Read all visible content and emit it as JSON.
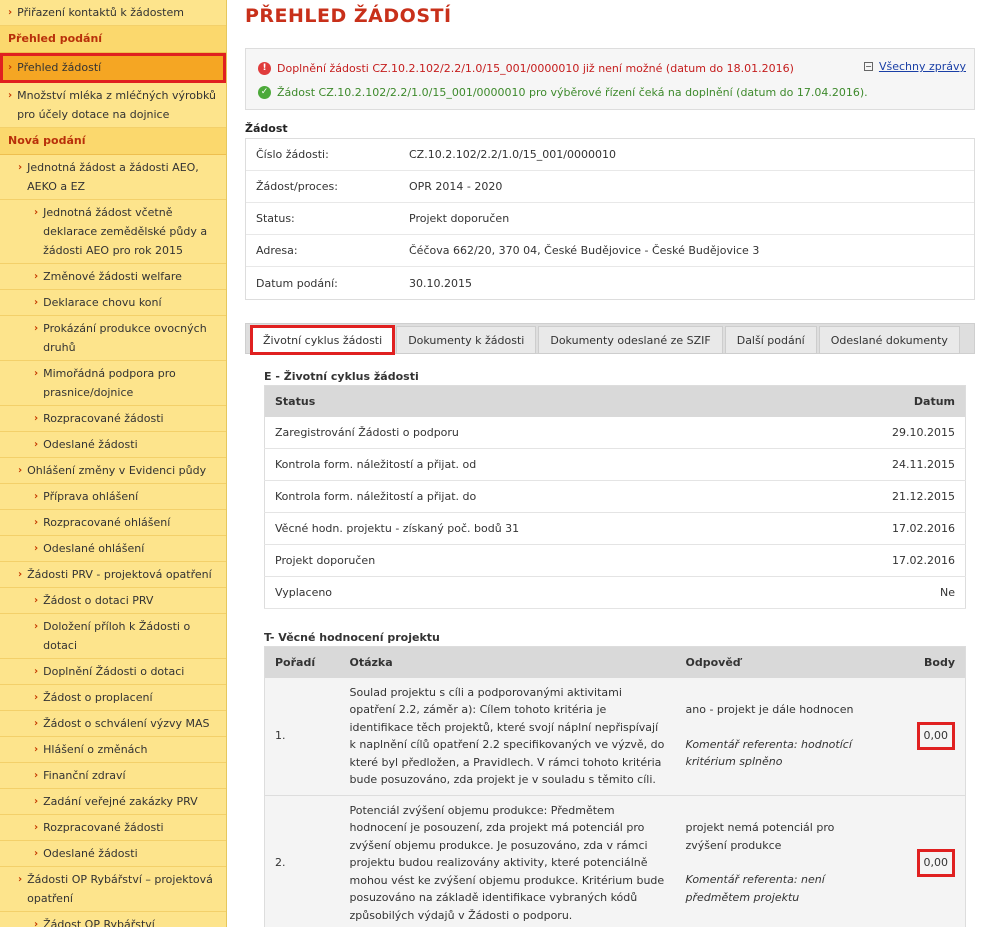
{
  "sidebar": {
    "items": [
      {
        "label": "Přiřazení kontaktů k žádostem",
        "level": 0,
        "type": "item"
      },
      {
        "label": "Přehled podání",
        "type": "section"
      },
      {
        "label": "Přehled žádostí",
        "level": 0,
        "type": "item",
        "active": true
      },
      {
        "label": "Množství mléka z mléčných výrobků pro účely dotace na dojnice",
        "level": 0,
        "type": "item"
      },
      {
        "label": "Nová podání",
        "type": "section"
      },
      {
        "label": "Jednotná žádost a žádosti AEO, AEKO a EZ",
        "level": 1,
        "type": "item"
      },
      {
        "label": "Jednotná žádost včetně deklarace zemědělské půdy a žádosti AEO pro rok 2015",
        "level": 2,
        "type": "item"
      },
      {
        "label": "Změnové žádosti welfare",
        "level": 2,
        "type": "item"
      },
      {
        "label": "Deklarace chovu koní",
        "level": 2,
        "type": "item"
      },
      {
        "label": "Prokázání produkce ovocných druhů",
        "level": 2,
        "type": "item"
      },
      {
        "label": "Mimořádná podpora pro prasnice/dojnice",
        "level": 2,
        "type": "item"
      },
      {
        "label": "Rozpracované žádosti",
        "level": 2,
        "type": "item"
      },
      {
        "label": "Odeslané žádosti",
        "level": 2,
        "type": "item"
      },
      {
        "label": "Ohlášení změny v Evidenci půdy",
        "level": 1,
        "type": "item"
      },
      {
        "label": "Příprava ohlášení",
        "level": 2,
        "type": "item"
      },
      {
        "label": "Rozpracované ohlášení",
        "level": 2,
        "type": "item"
      },
      {
        "label": "Odeslané ohlášení",
        "level": 2,
        "type": "item"
      },
      {
        "label": "Žádosti PRV - projektová opatření",
        "level": 1,
        "type": "item"
      },
      {
        "label": "Žádost o dotaci PRV",
        "level": 2,
        "type": "item"
      },
      {
        "label": "Doložení příloh k Žádosti o dotaci",
        "level": 2,
        "type": "item"
      },
      {
        "label": "Doplnění Žádosti o dotaci",
        "level": 2,
        "type": "item"
      },
      {
        "label": "Žádost o proplacení",
        "level": 2,
        "type": "item"
      },
      {
        "label": "Žádost o schválení výzvy MAS",
        "level": 2,
        "type": "item"
      },
      {
        "label": "Hlášení o změnách",
        "level": 2,
        "type": "item"
      },
      {
        "label": "Finanční zdraví",
        "level": 2,
        "type": "item"
      },
      {
        "label": "Zadání veřejné zakázky PRV",
        "level": 2,
        "type": "item"
      },
      {
        "label": "Rozpracované žádosti",
        "level": 2,
        "type": "item"
      },
      {
        "label": "Odeslané žádosti",
        "level": 2,
        "type": "item"
      },
      {
        "label": "Žádosti OP Rybářství – projektová opatření",
        "level": 1,
        "type": "item"
      },
      {
        "label": "Žádost OP Rybářství",
        "level": 2,
        "type": "item"
      }
    ]
  },
  "page": {
    "title": "PŘEHLED ŽÁDOSTÍ"
  },
  "messages": {
    "error": "Doplnění žádosti CZ.10.2.102/2.2/1.0/15_001/0000010 již není možné (datum do 18.01.2016)",
    "ok": "Žádost CZ.10.2.102/2.2/1.0/15_001/0000010 pro výběrové řízení čeká na doplnění (datum do 17.04.2016).",
    "all_link": "Všechny zprávy",
    "collapse_symbol": "−"
  },
  "zadost": {
    "title": "Žádost",
    "rows": [
      {
        "label": "Číslo žádosti:",
        "value": "CZ.10.2.102/2.2/1.0/15_001/0000010"
      },
      {
        "label": "Žádost/proces:",
        "value": "OPR 2014 - 2020"
      },
      {
        "label": "Status:",
        "value": "Projekt doporučen"
      },
      {
        "label": "Adresa:",
        "value": "Čéčova 662/20, 370 04, České Budějovice - České Budějovice 3"
      },
      {
        "label": "Datum podání:",
        "value": "30.10.2015"
      }
    ]
  },
  "tabs": [
    {
      "label": "Životní cyklus žádosti",
      "active": true
    },
    {
      "label": "Dokumenty k žádosti"
    },
    {
      "label": "Dokumenty odeslané ze SZIF"
    },
    {
      "label": "Další podání"
    },
    {
      "label": "Odeslané dokumenty"
    }
  ],
  "lifecycle": {
    "title": "E - Životní cyklus žádosti",
    "headers": {
      "status": "Status",
      "datum": "Datum"
    },
    "rows": [
      {
        "status": "Zaregistrování Žádosti o podporu",
        "datum": "29.10.2015"
      },
      {
        "status": "Kontrola form. náležitostí a přijat. od",
        "datum": "24.11.2015"
      },
      {
        "status": "Kontrola form. náležitostí a přijat. do",
        "datum": "21.12.2015"
      },
      {
        "status": "Věcné hodn. projektu - získaný poč. bodů 31",
        "datum": "17.02.2016"
      },
      {
        "status": "Projekt doporučen",
        "datum": "17.02.2016"
      },
      {
        "status": "Vyplaceno",
        "datum": "Ne"
      }
    ]
  },
  "evaluation": {
    "title": "T- Věcné hodnocení projektu",
    "headers": {
      "poradi": "Pořadí",
      "otazka": "Otázka",
      "odpoved": "Odpověď",
      "body": "Body"
    },
    "rows": [
      {
        "poradi": "1.",
        "otazka": "Soulad projektu s cíli a podporovanými aktivitami opatření 2.2, záměr a): Cílem tohoto kritéria je identifikace těch projektů, které svojí náplní nepřispívají k naplnění cílů opatření 2.2 specifikovaných ve výzvě, do které byl předložen, a Pravidlech. V rámci tohoto kritéria bude posuzováno, zda projekt je v souladu s těmito cíli.",
        "odpoved": "ano - projekt je dále hodnocen",
        "komentar": "Komentář referenta: hodnotící kritérium splněno",
        "body": "0,00"
      },
      {
        "poradi": "2.",
        "otazka": "Potenciál zvýšení objemu produkce: Předmětem hodnocení je posouzení, zda projekt má potenciál pro zvýšení objemu produkce. Je posuzováno, zda v rámci projektu budou realizovány aktivity, které potenciálně mohou vést ke zvýšení objemu produkce. Kritérium bude posuzováno na základě identifikace vybraných kódů způsobilých výdajů v Žádosti o podporu.",
        "odpoved": "projekt nemá potenciál pro zvýšení produkce",
        "komentar": "Komentář referenta: není předmětem projektu",
        "body": "0,00"
      }
    ]
  }
}
